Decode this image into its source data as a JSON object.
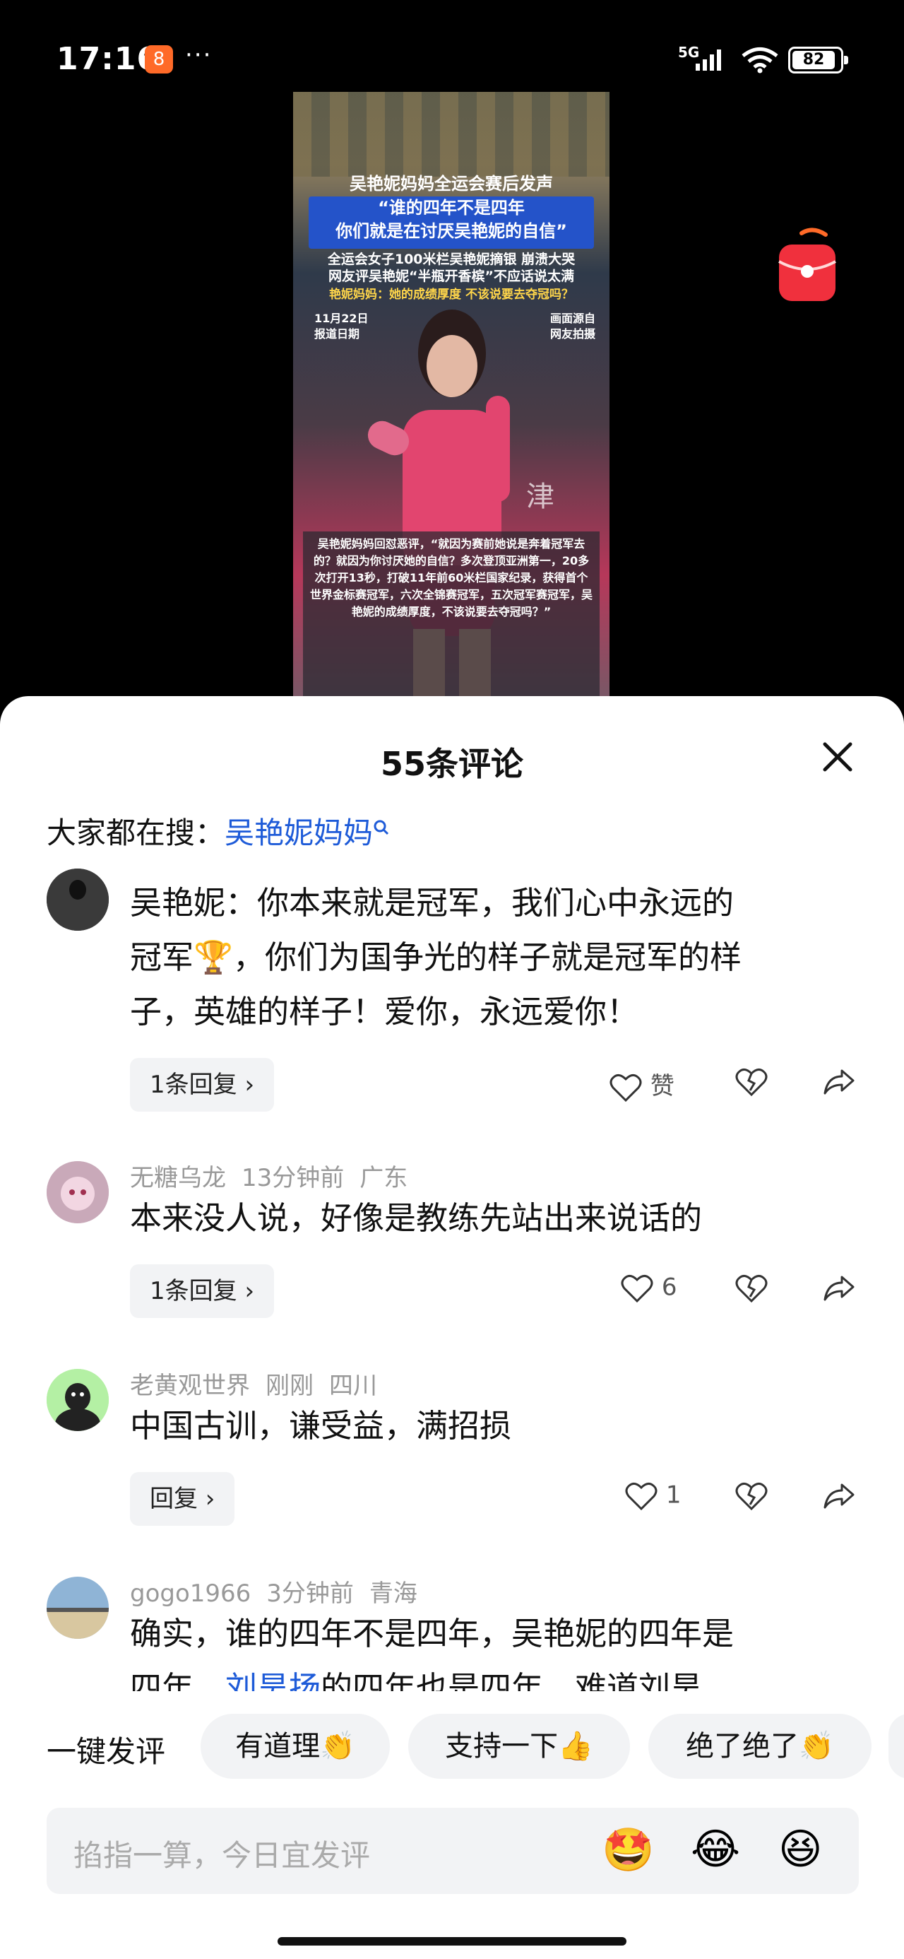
{
  "status_bar": {
    "time": "17:16",
    "app_badge": "8",
    "more": "···",
    "network": "5G",
    "battery": "82"
  },
  "video": {
    "headline": "吴艳妮妈妈全运会赛后发声",
    "quote_line1": "“谁的四年不是四年",
    "quote_line2": "你们就是在讨厌吴艳妮的自信”",
    "sub1": "全运会女子100米栏吴艳妮摘银 崩溃大哭",
    "sub2": "网友评吴艳妮“半瓶开香槟”不应话说太满",
    "sub3": "艳妮妈妈：她的成绩厚度 不该说要去夺冠吗？",
    "date_line1": "11月22日",
    "date_line2": "报道日期",
    "source_line1": "画面源自",
    "source_line2": "网友拍摄",
    "caption": "吴艳妮妈妈回怼恶评，“就因为赛前她说是奔着冠军去的？就因为你讨厌她的自信？多次登顶亚洲第一，20多次打开13秒，打破11年前60米栏国家纪录，获得首个世界金标赛冠军，六次全锦赛冠军，五次冠军赛冠军，吴艳妮的成绩厚度，不该说要去夺冠吗？”",
    "watermark": "津"
  },
  "sheet": {
    "title": "55条评论",
    "search_prefix": "大家都在搜：",
    "search_term": "吴艳妮妈妈"
  },
  "comments": [
    {
      "body_line1": "吴艳妮：你本来就是冠军，我们心中永远的",
      "body_line2": "冠军🏆，你们为国争光的样子就是冠军的样",
      "body_line3": "子，英雄的样子！爱你，永远爱你！",
      "reply_label": "1条回复 ›",
      "like": "赞"
    },
    {
      "user": "无糖乌龙",
      "time": "13分钟前",
      "location": "广东",
      "body_line1": "本来没人说，好像是教练先站出来说话的",
      "reply_label": "1条回复 ›",
      "like": "6"
    },
    {
      "user": "老黄观世界",
      "time": "刚刚",
      "location": "四川",
      "body_line1": "中国古训，谦受益，满招损",
      "reply_label": "回复 ›",
      "like": "1"
    },
    {
      "user": "gogo1966",
      "time": "3分钟前",
      "location": "青海",
      "body_line1": "确实，谁的四年不是四年，吴艳妮的四年是",
      "body_line2_a": "四年，",
      "body_line2_link": "刘昊扬",
      "body_line2_b": "的四年也是四年，难道刘昊"
    }
  ],
  "quick_comment": {
    "label": "一键发评",
    "chips": [
      "有道理👏",
      "支持一下👍",
      "绝了绝了👏"
    ]
  },
  "input": {
    "placeholder": "掐指一算，今日宜发评",
    "emojis": [
      "🤩",
      "😂",
      "😆"
    ]
  }
}
